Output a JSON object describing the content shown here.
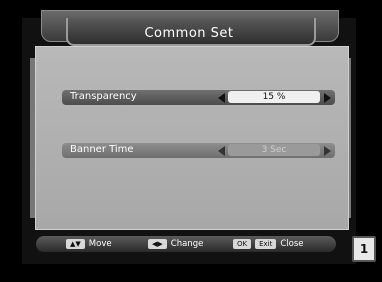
{
  "title": "Common Set",
  "rows": [
    {
      "label": "Transparency",
      "value": "15 %",
      "state": "active"
    },
    {
      "label": "Banner Time",
      "value": "3 Sec",
      "state": "inactive"
    }
  ],
  "footer": {
    "move": {
      "key": "▲▼",
      "label": "Move"
    },
    "change": {
      "key": "◀▶",
      "label": "Change"
    },
    "ok": {
      "key": "OK"
    },
    "exit": {
      "key": "Exit",
      "label": "Close"
    }
  },
  "badge": "1",
  "colors": {
    "background": "#000000",
    "panel": "#b0b0b0",
    "active_row": "#5c5c5c"
  }
}
